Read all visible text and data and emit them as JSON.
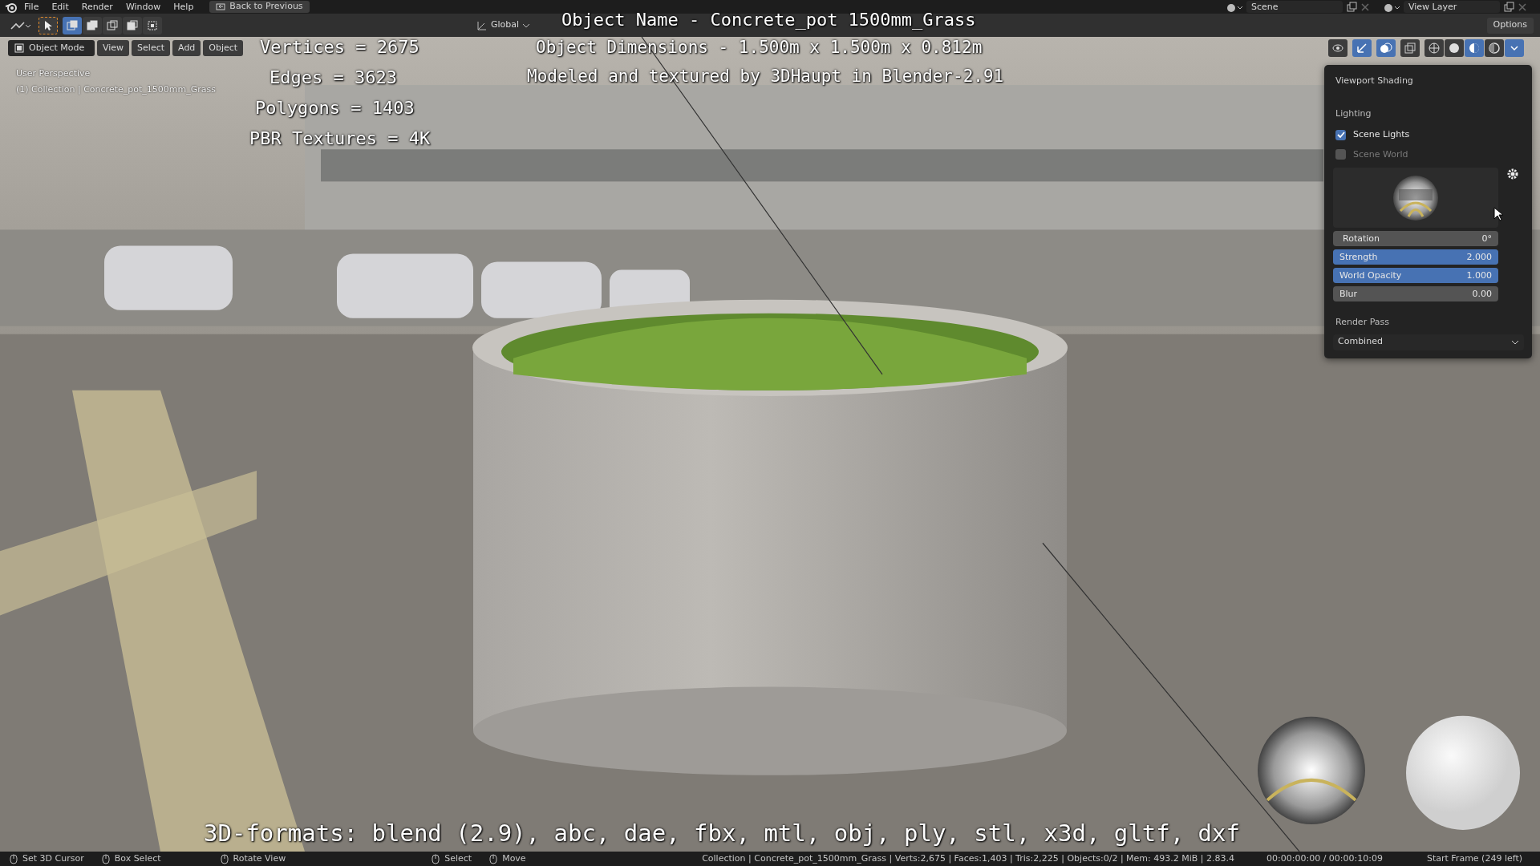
{
  "menu_bar": {
    "menus": [
      "File",
      "Edit",
      "Render",
      "Window",
      "Help"
    ],
    "back_button": "Back to Previous",
    "scene": "Scene",
    "view_layer": "View Layer"
  },
  "tool_header": {
    "select_modes": [
      {
        "selected": true
      },
      {
        "selected": false
      },
      {
        "selected": false
      },
      {
        "selected": false
      },
      {
        "selected": false
      }
    ],
    "orientation": "Global",
    "options": "Options"
  },
  "viewport_header": {
    "mode": "Object Mode",
    "menus": [
      "View",
      "Select",
      "Add",
      "Object"
    ],
    "shading_modes": [
      {
        "selected": false
      },
      {
        "selected": false
      },
      {
        "selected": true
      },
      {
        "selected": false
      }
    ]
  },
  "viewport": {
    "view_name": "User Perspective",
    "collection": "(1) Collection | Concrete_pot_1500mm_Grass"
  },
  "overlay_text": {
    "title": "Object Name - Concrete_pot 1500mm_Grass",
    "stats": [
      "Vertices = 2675",
      "Edges = 3623",
      "Polygons = 1403",
      "PBR Textures = 4K"
    ],
    "dimensions": "Object Dimensions -  1.500m x 1.500m x 0.812m",
    "credit": "Modeled and textured by 3DHaupt in Blender-2.91",
    "formats": "3D-formats: blend (2.9), abc, dae, fbx, mtl, obj, ply, stl, x3d, gltf, dxf"
  },
  "shading_popover": {
    "title": "Viewport Shading",
    "lighting_label": "Lighting",
    "options": [
      {
        "label": "Scene Lights",
        "checked": true
      },
      {
        "label": "Scene World",
        "checked": false
      }
    ],
    "fields": [
      {
        "kind": "number",
        "label": "Rotation",
        "value": "0°"
      },
      {
        "kind": "slider",
        "label": "Strength",
        "value": "2.000",
        "level": 1
      },
      {
        "kind": "slider",
        "label": "World Opacity",
        "value": "1.000",
        "level": 1
      },
      {
        "kind": "slider",
        "label": "Blur",
        "value": "0.00",
        "level": 0
      }
    ],
    "render_pass_label": "Render Pass",
    "render_pass": "Combined"
  },
  "status_bar": {
    "hints": [
      "Set 3D Cursor",
      "Box Select",
      "Rotate View",
      "Select",
      "Move"
    ],
    "info": "Collection | Concrete_pot_1500mm_Grass | Verts:2,675 | Faces:1,403 | Tris:2,225 | Objects:0/2 | Mem: 493.2 MiB | 2.83.4",
    "time": "00:00:00:00 / 00:00:10:09",
    "frame": "Start Frame (249 left)"
  }
}
